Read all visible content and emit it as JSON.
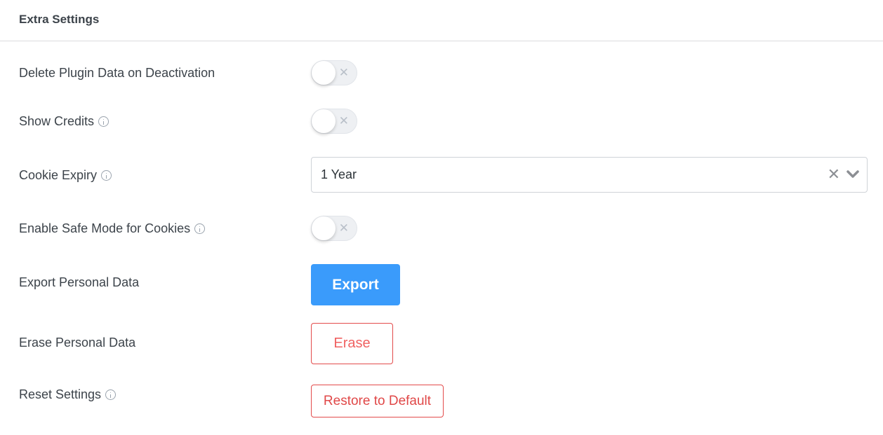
{
  "header": {
    "title": "Extra Settings"
  },
  "settings": {
    "delete_plugin_data": {
      "label": "Delete Plugin Data on Deactivation",
      "enabled": false,
      "off_glyph": "✕"
    },
    "show_credits": {
      "label": "Show Credits",
      "enabled": false,
      "off_glyph": "✕"
    },
    "cookie_expiry": {
      "label": "Cookie Expiry",
      "value": "1 Year",
      "clear_glyph": "✕"
    },
    "safe_mode": {
      "label": "Enable Safe Mode for Cookies",
      "enabled": false,
      "off_glyph": "✕"
    },
    "export": {
      "label": "Export Personal Data",
      "button": "Export"
    },
    "erase": {
      "label": "Erase Personal Data",
      "button": "Erase"
    },
    "reset": {
      "label": "Reset Settings",
      "button": "Restore to Default"
    }
  },
  "colors": {
    "primary": "#3a9bfb",
    "danger": "#e34b4b",
    "text": "#3c434a"
  }
}
